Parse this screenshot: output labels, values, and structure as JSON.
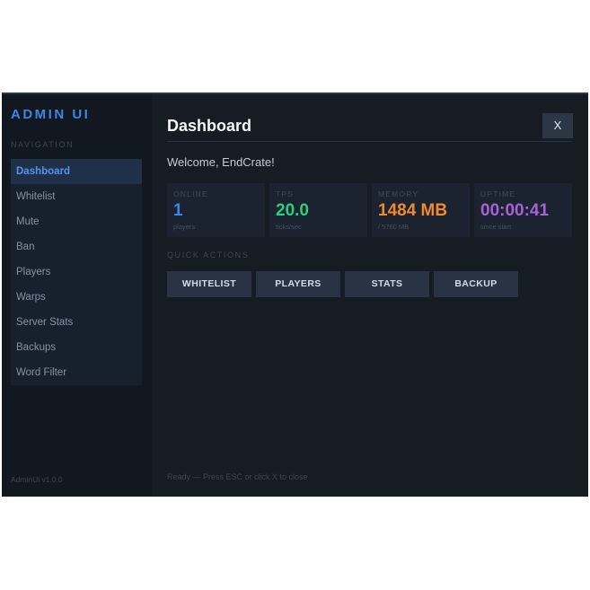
{
  "sidebar": {
    "brand": "ADMIN UI",
    "nav_label": "NAVIGATION",
    "items": [
      {
        "label": "Dashboard",
        "active": true
      },
      {
        "label": "Whitelist"
      },
      {
        "label": "Mute"
      },
      {
        "label": "Ban"
      },
      {
        "label": "Players"
      },
      {
        "label": "Warps"
      },
      {
        "label": "Server Stats"
      },
      {
        "label": "Backups"
      },
      {
        "label": "Word Filter"
      }
    ],
    "version": "AdminUi v1.0.0"
  },
  "header": {
    "title": "Dashboard",
    "close_label": "X"
  },
  "welcome": "Welcome, EndCrate!",
  "stats": [
    {
      "label": "ONLINE",
      "value": "1",
      "sub": "players",
      "color": "#3d86e6"
    },
    {
      "label": "TPS",
      "value": "20.0",
      "sub": "ticks/sec",
      "color": "#2fcf7a"
    },
    {
      "label": "MEMORY",
      "value": "1484 MB",
      "sub": "/ 5760 MB",
      "color": "#f08a2c"
    },
    {
      "label": "UPTIME",
      "value": "00:00:41",
      "sub": "since start",
      "color": "#a861d6"
    }
  ],
  "quick_actions": {
    "label": "QUICK ACTIONS",
    "buttons": [
      "WHITELIST",
      "PLAYERS",
      "STATS",
      "BACKUP"
    ]
  },
  "status": "Ready — Press ESC or click X to close",
  "colors": {
    "accent": "#3d86e6",
    "window_bg": "#161c24",
    "sidebar_bg": "#121820"
  }
}
